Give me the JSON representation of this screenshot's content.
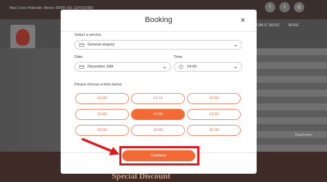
{
  "background": {
    "address": "Maa Cross Hollander, Mexico 56000   +52 1234 567890",
    "nav_items": [
      "PUBLIC MUSIC",
      "MORE"
    ],
    "social_icons": [
      "facebook-icon",
      "twitter-icon",
      "instagram-icon"
    ],
    "special_text": "Special Discount",
    "side_text": "Read more",
    "colors": {
      "topbar": "#3a2f2d",
      "footer": "#3e2a26"
    }
  },
  "modal": {
    "title": "Booking",
    "close_symbol": "×",
    "service": {
      "label": "Select a service",
      "value": "General enquiry",
      "icon": "calendar-icon"
    },
    "date": {
      "label": "Date",
      "value": "December 16th",
      "icon": "calendar-icon"
    },
    "time": {
      "label": "Time",
      "value": "14:00",
      "icon": "clock-icon"
    },
    "slots_label": "Please choose a time below",
    "slots": [
      {
        "time": "13:00",
        "selected": false
      },
      {
        "time": "13:15",
        "selected": false
      },
      {
        "time": "13:30",
        "selected": false
      },
      {
        "time": "13:45",
        "selected": false
      },
      {
        "time": "14:00",
        "selected": true
      },
      {
        "time": "14:15",
        "selected": false
      },
      {
        "time": "14:30",
        "selected": false
      },
      {
        "time": "14:45",
        "selected": false
      },
      {
        "time": "15:00",
        "selected": false
      }
    ],
    "continue_label": "Continue"
  },
  "colors": {
    "accent": "#f36a34",
    "highlight_box": "#e3151b",
    "overlay": "#5a5a5a"
  }
}
